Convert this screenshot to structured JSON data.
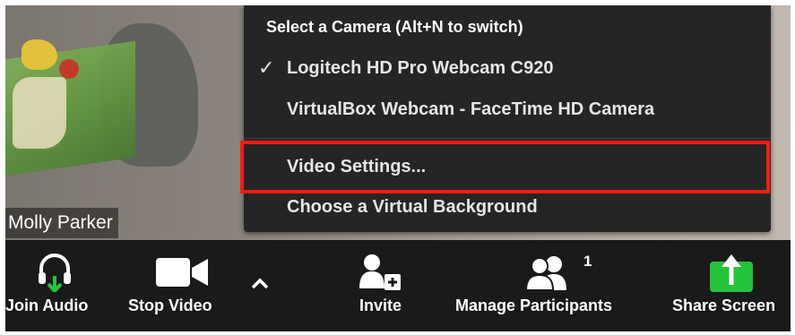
{
  "video": {
    "participant_name": "Molly Parker"
  },
  "camera_menu": {
    "header": "Select a Camera (Alt+N to switch)",
    "items": [
      {
        "label": "Logitech HD Pro Webcam C920",
        "checked": true
      },
      {
        "label": "VirtualBox Webcam - FaceTime HD Camera",
        "checked": false
      },
      {
        "label": "Video Settings...",
        "checked": false,
        "highlighted": true
      },
      {
        "label": "Choose a Virtual Background",
        "checked": false
      }
    ],
    "check_glyph": "✓"
  },
  "toolbar": {
    "join_audio": {
      "label": "Join Audio",
      "icon": "headphones-icon"
    },
    "stop_video": {
      "label": "Stop Video",
      "icon": "video-camera-icon"
    },
    "video_options": {
      "icon": "chevron-up-icon",
      "glyph": "^"
    },
    "invite": {
      "label": "Invite",
      "icon": "add-person-icon"
    },
    "manage_participants": {
      "label": "Manage Participants",
      "icon": "participants-icon",
      "count": "1"
    },
    "share_screen": {
      "label": "Share Screen",
      "icon": "share-screen-icon"
    }
  },
  "colors": {
    "accent_green": "#24c43b",
    "highlight_red": "#ff1b0f",
    "toolbar_bg": "#1a1a1a",
    "menu_bg": "#252525"
  }
}
